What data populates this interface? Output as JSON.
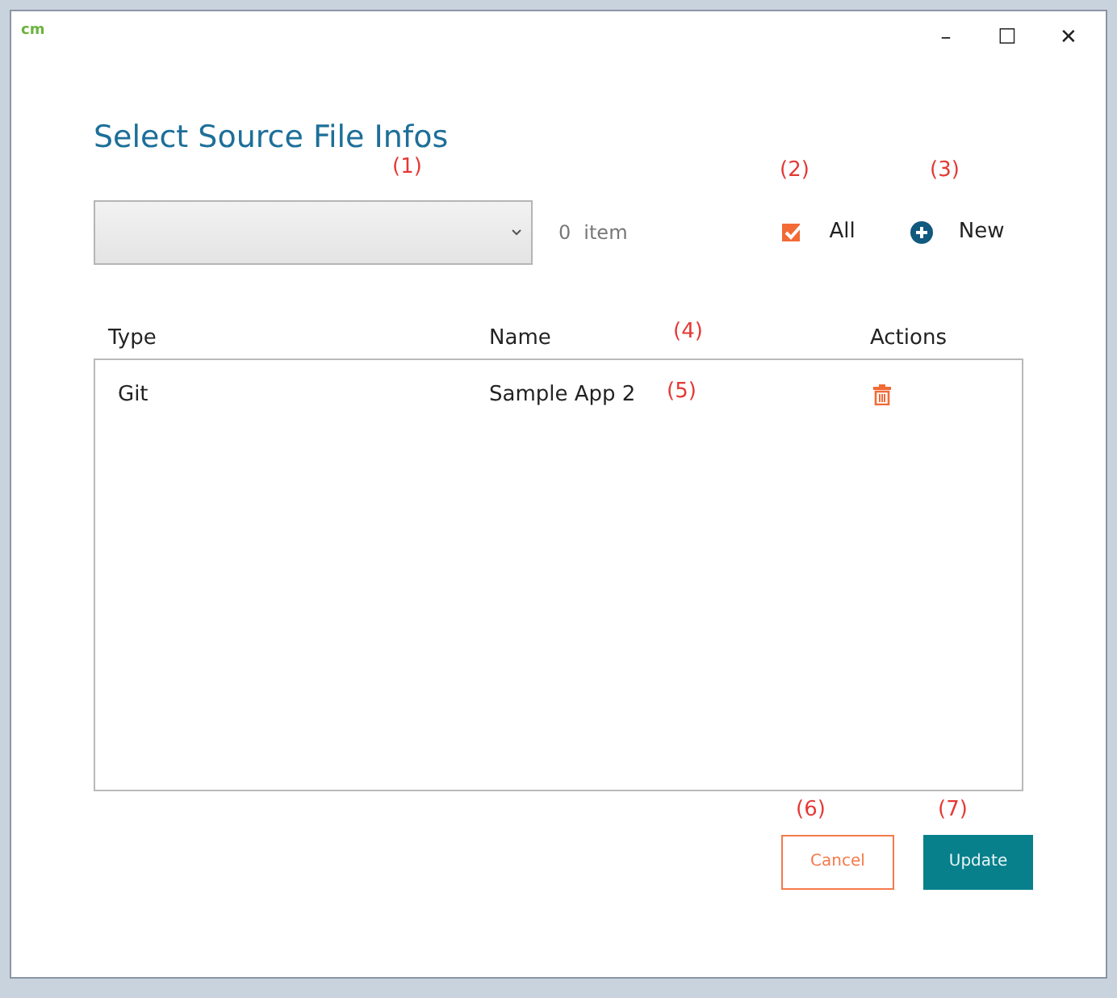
{
  "window": {
    "logo": "cm",
    "controls": [
      "–",
      "☐",
      "✕"
    ]
  },
  "title": "Select Source File Infos",
  "source_select": {
    "annotation": "(1)"
  },
  "item_count": {
    "count": "0",
    "unit": "item"
  },
  "all_checkbox": {
    "label": "All",
    "checked": true,
    "annotation": "(2)"
  },
  "new_button": {
    "label": "New",
    "annotation": "(3)"
  },
  "table": {
    "columns": [
      "Type",
      "Name",
      "Actions"
    ],
    "header_annotation": "(4)",
    "rows": [
      {
        "type": "Git",
        "name": "Sample App 2",
        "annotation": "(5)"
      }
    ]
  },
  "buttons": [
    {
      "kind": "outline",
      "label": "Cancel",
      "annotation": "(6)"
    },
    {
      "kind": "primary",
      "label": "Update",
      "annotation": "(7)"
    }
  ]
}
